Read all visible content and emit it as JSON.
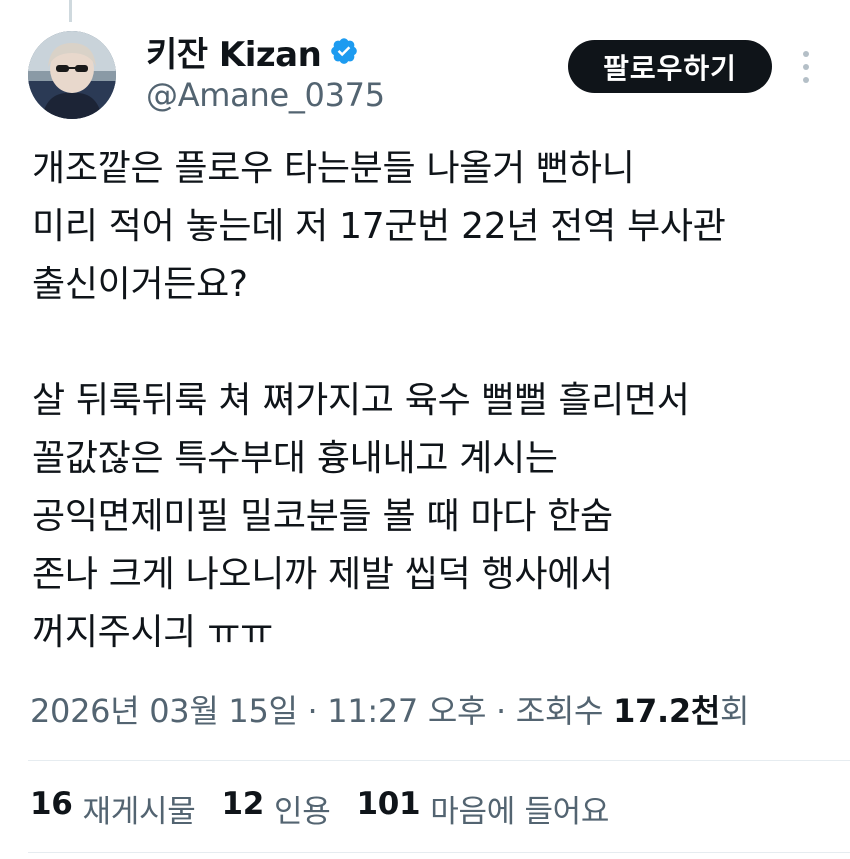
{
  "author": {
    "display_name": "키잔 Kizan",
    "handle": "@Amane_0375",
    "verified": true
  },
  "follow_button": {
    "label": "팔로우하기"
  },
  "tweet": {
    "paragraph1": "개조깥은 플로우 타는분들 나올거 뻔하니\n미리 적어 놓는데 저 17군번 22년 전역 부사관\n출신이거든요?",
    "paragraph2": "살 뒤룩뒤룩 쳐 쪄가지고 육수 뻘뻘 흘리면서\n꼴값잖은 특수부대 흉내내고 계시는\n공익면제미필 밀코분들 볼 때 마다 한숨\n존나 크게 나오니까 제발 씹덕 행사에서\n꺼지주시긔 ㅠㅠ"
  },
  "meta": {
    "date": "2026년 03월 15일",
    "sep1": " · ",
    "time": "11:27 오후",
    "sep2": " · ",
    "views_label": "조회수 ",
    "views_count": "17.2천",
    "views_suffix": "회"
  },
  "stats": {
    "reposts_count": "16",
    "reposts_label": "재게시물",
    "quotes_count": "12",
    "quotes_label": "인용",
    "likes_count": "101",
    "likes_label": "마음에 들어요"
  },
  "colors": {
    "text_primary": "#0f1419",
    "text_secondary": "#536471",
    "verified_blue": "#1d9bf0",
    "follow_bg": "#0f1419",
    "divider": "#e6ecf0"
  }
}
